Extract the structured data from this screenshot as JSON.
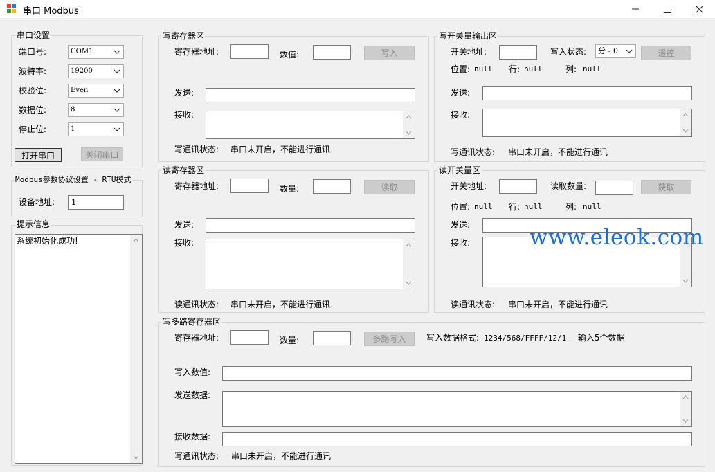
{
  "window": {
    "title": "串口 Modbus",
    "controls": {
      "minimize": "—",
      "maximize": "☐",
      "close": "✕"
    }
  },
  "serial_settings": {
    "title": "串口设置",
    "port": {
      "label": "端口号:",
      "value": "COM1"
    },
    "baud": {
      "label": "波特率:",
      "value": "19200"
    },
    "parity": {
      "label": "校验位:",
      "value": "Even"
    },
    "data_bits": {
      "label": "数据位:",
      "value": "8"
    },
    "stop_bits": {
      "label": "停止位:",
      "value": "1"
    },
    "open_button": "打开串口",
    "close_button": "关闭串口"
  },
  "modbus_settings": {
    "title": "Modbus参数协议设置 - RTU模式",
    "device_address": {
      "label": "设备地址:",
      "value": "1"
    }
  },
  "info": {
    "title": "提示信息",
    "log": "系统初始化成功!"
  },
  "write_register": {
    "title": "写寄存器区",
    "address_label": "寄存器地址:",
    "value_label": "数值:",
    "write_button": "写入",
    "send_label": "发送:",
    "receive_label": "接收:",
    "status_label": "写通讯状态:",
    "status_value": "串口未开启，不能进行通讯"
  },
  "write_coil": {
    "title": "写开关量输出区",
    "address_label": "开关地址:",
    "state_label": "写入状态:",
    "state_value": "分 - 0",
    "control_button": "遥控",
    "position_label": "位置:",
    "position_value": "null",
    "row_label": "行:",
    "row_value": "null",
    "col_label": "列:",
    "col_value": "null",
    "send_label": "发送:",
    "receive_label": "接收:",
    "status_label": "写通讯状态:",
    "status_value": "串口未开启，不能进行通讯"
  },
  "read_register": {
    "title": "读寄存器区",
    "address_label": "寄存器地址:",
    "count_label": "数量:",
    "read_button": "读取",
    "send_label": "发送:",
    "receive_label": "接收:",
    "status_label": "读通讯状态:",
    "status_value": "串口未开启，不能进行通讯"
  },
  "read_coil": {
    "title": "读开关量区",
    "address_label": "开关地址:",
    "count_label": "读取数量:",
    "get_button": "获取",
    "position_label": "位置:",
    "position_value": "null",
    "row_label": "行:",
    "row_value": "null",
    "col_label": "列:",
    "col_value": "null",
    "send_label": "发送:",
    "receive_label": "接收:",
    "status_label": "读通讯状态:",
    "status_value": "串口未开启，不能进行通讯"
  },
  "write_multi": {
    "title": "写多路寄存器区",
    "address_label": "寄存器地址:",
    "count_label": "数量:",
    "write_button": "多路写入",
    "format_label": "写入数据格式:",
    "format_value": "1234/568/FFFF/12/1",
    "format_hint": "— 输入5个数据",
    "values_label": "写入数值:",
    "send_label": "发送数据:",
    "receive_label": "接收数据:",
    "status_label": "写通讯状态:",
    "status_value": "串口未开启，不能进行通讯"
  },
  "watermark": "www.eleok.com",
  "colors": {
    "window_bg": "#f0f0f0",
    "watermark": "#1a6fd6",
    "disabled_button": "#cccccc"
  }
}
